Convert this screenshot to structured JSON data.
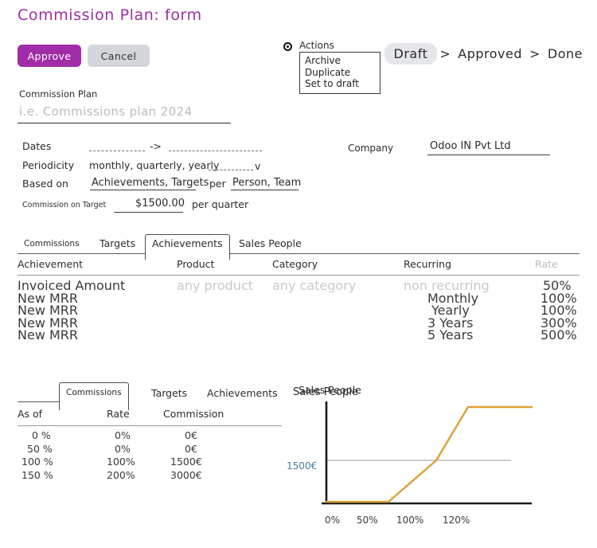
{
  "page_title": "Commission Plan: form",
  "title_color": "#9b2fa0",
  "buttons": {
    "approve": "Approve",
    "approve_color": "#a12ca8",
    "cancel": "Cancel",
    "cancel_color": "#d3d6da"
  },
  "actions": {
    "label": "Actions",
    "items": [
      "Archive",
      "Duplicate",
      "Set to draft"
    ]
  },
  "status_bar": {
    "states": [
      "Draft",
      "Approved",
      "Done"
    ],
    "current": "Draft",
    "separator": ">"
  },
  "commission_plan_field": {
    "label": "Commission Plan",
    "value": "",
    "placeholder": "i.e. Commissions plan 2024"
  },
  "fields": {
    "dates": {
      "label": "Dates",
      "from": "",
      "to": "",
      "arrow": "->"
    },
    "periodicity": {
      "label": "Periodicity",
      "value": "monthly, quarterly, yearly",
      "caret": "v"
    },
    "based_on": {
      "label": "Based on",
      "value": "Achievements, Targets",
      "per_label": "per",
      "per_value": "Person, Team"
    },
    "commission_on_target": {
      "label": "Commission on Target",
      "value": "$1500.00",
      "suffix": "per quarter"
    }
  },
  "company": {
    "label": "Company",
    "value": "Odoo IN Pvt Ltd"
  },
  "main_tabs": {
    "items": [
      "Commissions",
      "Targets",
      "Achievements",
      "Sales People"
    ],
    "active": "Achievements"
  },
  "achievements_table": {
    "columns": [
      "Achievement",
      "Product",
      "Category",
      "Recurring",
      "Rate"
    ],
    "rows": [
      {
        "achievement": "Invoiced Amount",
        "product": "any product",
        "category": "any category",
        "recurring": "non recurring",
        "rate": "50%",
        "muted": true
      },
      {
        "achievement": "New MRR",
        "product": "",
        "category": "",
        "recurring": "Monthly",
        "rate": "100%",
        "muted": false
      },
      {
        "achievement": "New MRR",
        "product": "",
        "category": "",
        "recurring": "Yearly",
        "rate": "100%",
        "muted": false
      },
      {
        "achievement": "New MRR",
        "product": "",
        "category": "",
        "recurring": "3 Years",
        "rate": "300%",
        "muted": false
      },
      {
        "achievement": "New MRR",
        "product": "",
        "category": "",
        "recurring": "5 Years",
        "rate": "500%",
        "muted": false
      }
    ]
  },
  "lower_tabs": {
    "items": [
      "Commissions",
      "Targets",
      "Achievements",
      "Sales People"
    ],
    "active": "Commissions"
  },
  "commissions_table": {
    "columns": [
      "As of",
      "Rate",
      "Commission"
    ],
    "rows": [
      {
        "as_of": "0  %",
        "rate": "0%",
        "commission": "0€"
      },
      {
        "as_of": "50 %",
        "rate": "0%",
        "commission": "0€"
      },
      {
        "as_of": "100 %",
        "rate": "100%",
        "commission": "1500€"
      },
      {
        "as_of": "150 %",
        "rate": "200%",
        "commission": "3000€"
      }
    ]
  },
  "chart_data": {
    "type": "line",
    "title": "Sales People",
    "xlabel": "",
    "ylabel": "1500€",
    "line_color": "#d9a036",
    "gridline_color": "#cccccc",
    "ylabel_color": "#4a7c9c",
    "x": [
      0,
      50,
      100,
      120,
      150
    ],
    "values": [
      0,
      0,
      1500,
      3000,
      3000
    ],
    "categories": [
      "0%",
      "50%",
      "100%",
      "120%"
    ],
    "tick_labels": [
      "0%",
      "50%",
      "100%",
      "120%"
    ],
    "ylim": [
      0,
      3200
    ],
    "xlim": [
      0,
      155
    ],
    "reference_line": {
      "value": 1500,
      "label": "1500€"
    },
    "grid": false,
    "legend": "none"
  }
}
